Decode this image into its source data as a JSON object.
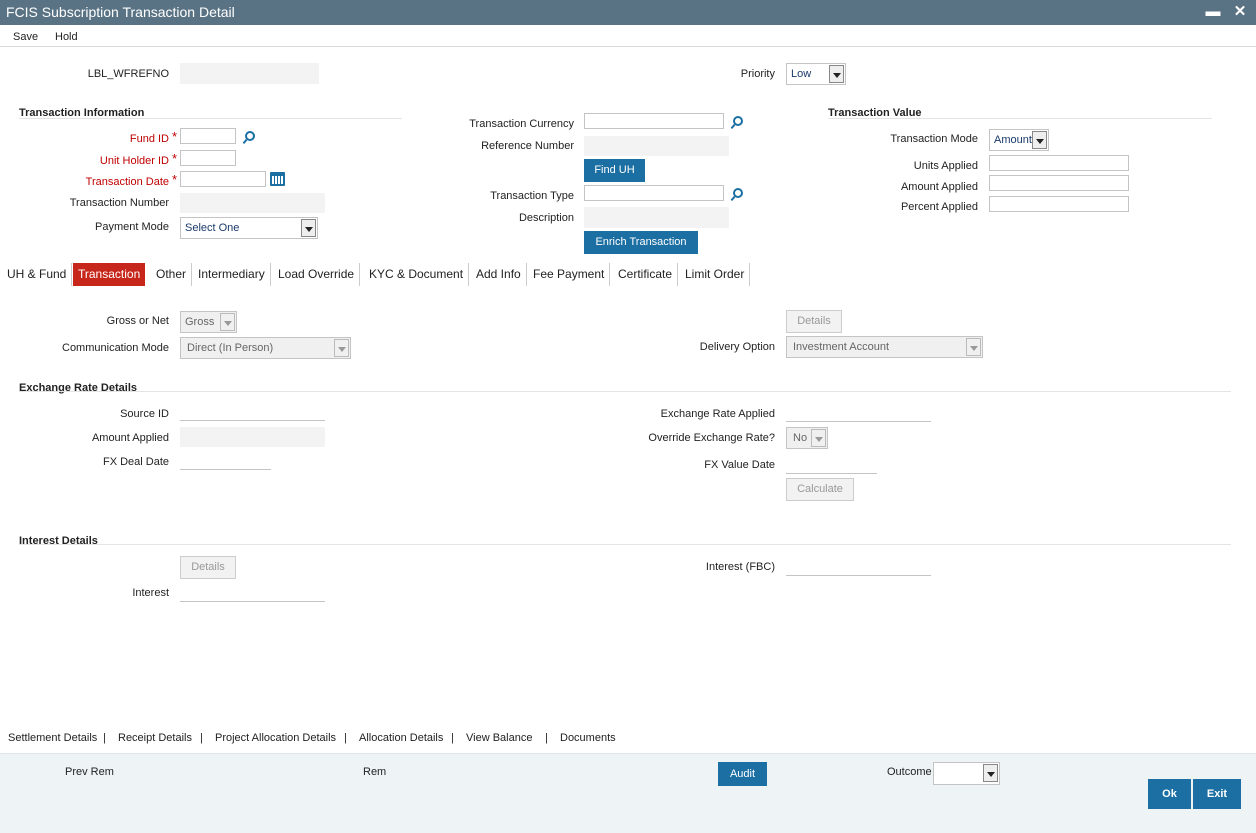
{
  "window": {
    "title": "FCIS Subscription Transaction Detail",
    "minimize": "▬",
    "close": "✕"
  },
  "menu": {
    "save": "Save",
    "hold": "Hold"
  },
  "header": {
    "wfrefno_label": "LBL_WFREFNO",
    "priority_label": "Priority",
    "priority_value": "Low"
  },
  "txn_info": {
    "title": "Transaction Information",
    "fund_id": "Fund ID",
    "unit_holder_id": "Unit Holder ID",
    "transaction_date": "Transaction Date",
    "transaction_number": "Transaction Number",
    "payment_mode": "Payment Mode",
    "payment_mode_value": "Select One",
    "required_mark": "*"
  },
  "txn_mid": {
    "currency": "Transaction Currency",
    "reference_number": "Reference Number",
    "find_uh": "Find UH",
    "transaction_type": "Transaction Type",
    "description": "Description",
    "enrich": "Enrich Transaction"
  },
  "txn_value": {
    "title": "Transaction Value",
    "mode": "Transaction Mode",
    "mode_value": "Amount",
    "units_applied": "Units Applied",
    "amount_applied": "Amount Applied",
    "percent_applied": "Percent Applied"
  },
  "tabs": [
    "UH & Fund",
    "Transaction",
    "Other",
    "Intermediary",
    "Load Override",
    "KYC & Document",
    "Add Info",
    "Fee Payment",
    "Certificate",
    "Limit Order"
  ],
  "transaction_tab": {
    "gross_or_net": "Gross or Net",
    "gross_value": "Gross",
    "comm_mode": "Communication Mode",
    "comm_mode_value": "Direct (In Person)",
    "details": "Details",
    "delivery_option": "Delivery Option",
    "delivery_value": "Investment Account"
  },
  "exchange": {
    "title": "Exchange Rate Details",
    "source_id": "Source ID",
    "amount_applied": "Amount Applied",
    "fx_deal_date": "FX Deal Date",
    "rate_applied": "Exchange Rate Applied",
    "override": "Override Exchange Rate?",
    "override_value": "No",
    "fx_value_date": "FX Value Date",
    "calculate": "Calculate"
  },
  "interest": {
    "title": "Interest Details",
    "details": "Details",
    "interest": "Interest",
    "interest_fbc": "Interest (FBC)"
  },
  "bottom_links": [
    "Settlement Details",
    "Receipt Details",
    "Project Allocation Details",
    "Allocation Details",
    "View Balance",
    "Documents"
  ],
  "bottom_sep": "|",
  "footer": {
    "prev_rem": "Prev Rem",
    "rem": "Rem",
    "audit": "Audit",
    "outcome": "Outcome",
    "ok": "Ok",
    "exit": "Exit"
  }
}
